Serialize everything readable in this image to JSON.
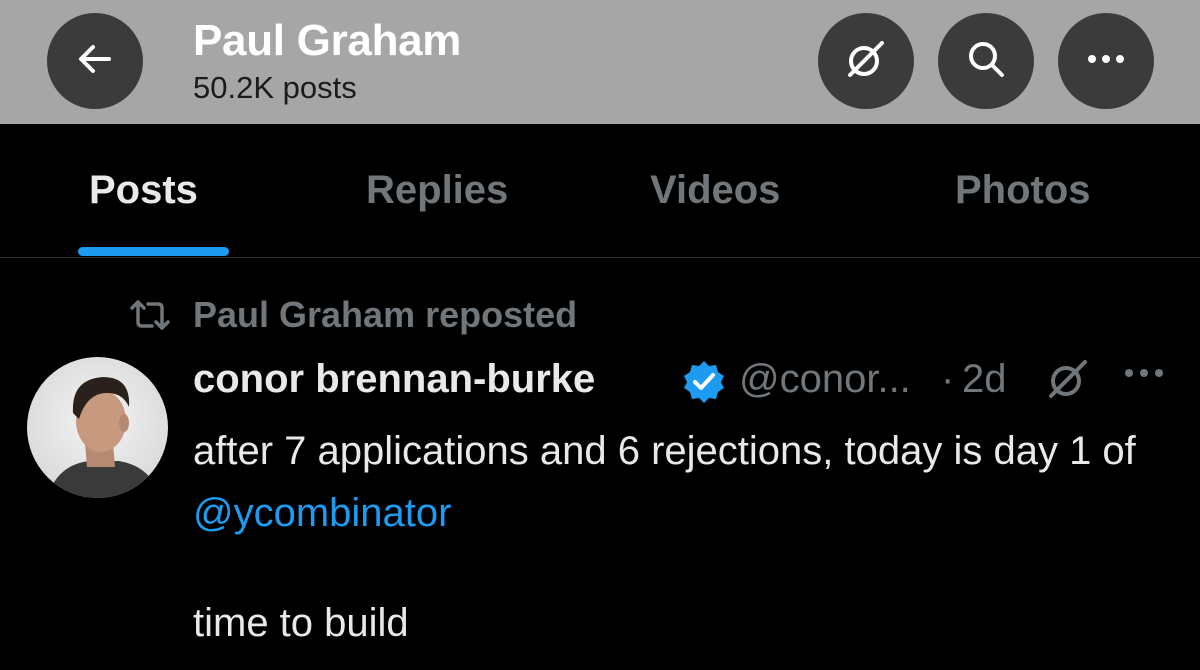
{
  "header": {
    "title": "Paul Graham",
    "subtitle": "50.2K posts",
    "buttons": {
      "back": "arrow-left-icon",
      "grok": "grok-icon",
      "search": "search-icon",
      "more": "more-horizontal-icon"
    }
  },
  "tabs": [
    {
      "label": "Posts",
      "active": true
    },
    {
      "label": "Replies",
      "active": false
    },
    {
      "label": "Videos",
      "active": false
    },
    {
      "label": "Photos",
      "active": false
    }
  ],
  "post": {
    "repost_label": "Paul Graham reposted",
    "author_name": "conor brennan-burke",
    "verified": true,
    "handle": "@conor...",
    "separator": "·",
    "time": "2d",
    "body_text": "after 7 applications and 6 rejections, today is day 1 of ",
    "mention": "@ycombinator",
    "body_last_line": "time to build"
  },
  "colors": {
    "header_bg": "#a6a6a6",
    "button_bg": "#3b3b3b",
    "accent": "#1d9bf0",
    "muted_text": "#71767b",
    "text": "#e7e9ea",
    "background": "#000000"
  }
}
